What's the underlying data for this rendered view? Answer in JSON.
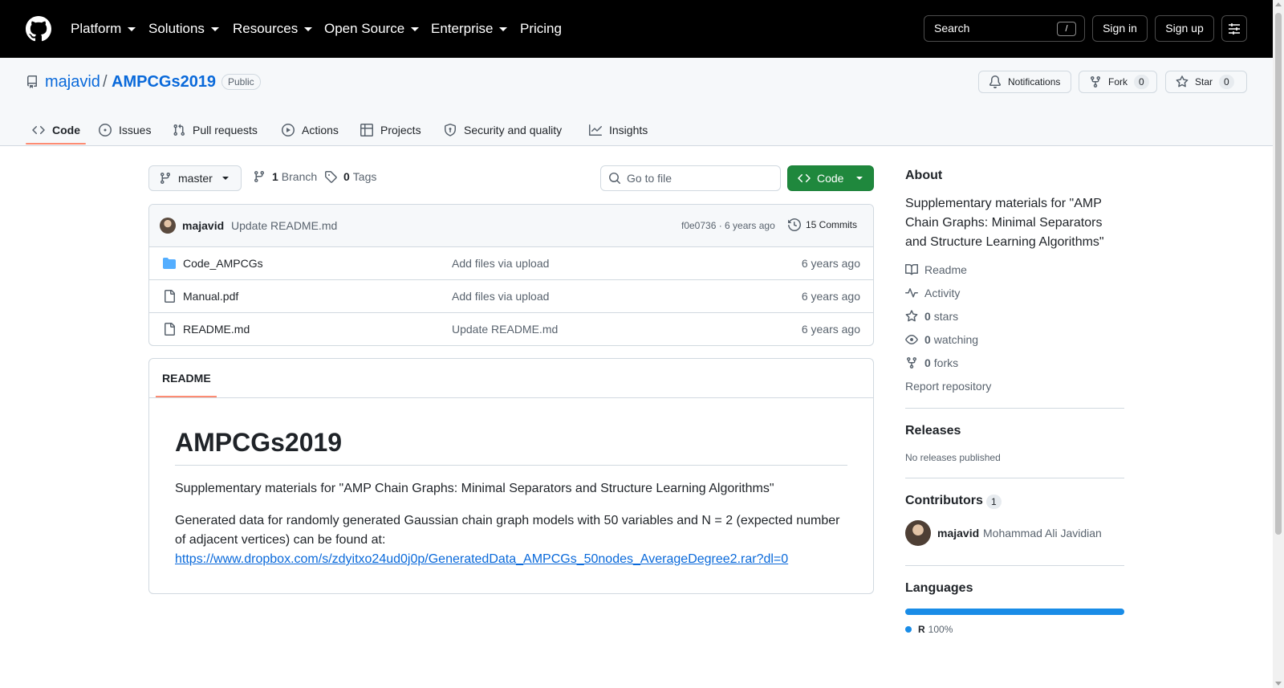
{
  "global_nav": {
    "logo": "github-mark-icon",
    "items": [
      {
        "label": "Platform",
        "has_dropdown": true
      },
      {
        "label": "Solutions",
        "has_dropdown": true
      },
      {
        "label": "Resources",
        "has_dropdown": true
      },
      {
        "label": "Open Source",
        "has_dropdown": true
      },
      {
        "label": "Enterprise",
        "has_dropdown": true
      },
      {
        "label": "Pricing",
        "has_dropdown": false
      }
    ],
    "search_label": "Search",
    "search_shortcut": "/",
    "sign_in": "Sign in",
    "sign_up": "Sign up"
  },
  "repo": {
    "owner": "majavid",
    "separator": "/",
    "name": "AMPCGs2019",
    "visibility": "Public",
    "actions": {
      "notifications": "Notifications",
      "fork_label": "Fork",
      "fork_count": "0",
      "star_label": "Star",
      "star_count": "0"
    },
    "tabs": [
      {
        "label": "Code",
        "icon": "code-icon",
        "active": true
      },
      {
        "label": "Issues",
        "icon": "issue-opened-icon"
      },
      {
        "label": "Pull requests",
        "icon": "git-pull-request-icon"
      },
      {
        "label": "Actions",
        "icon": "play-icon"
      },
      {
        "label": "Projects",
        "icon": "table-icon"
      },
      {
        "label": "Security and quality",
        "icon": "shield-icon"
      },
      {
        "label": "Insights",
        "icon": "graph-icon"
      }
    ]
  },
  "toolbar": {
    "branch": "master",
    "branch_count": "1",
    "branch_label": "Branch",
    "tag_count": "0",
    "tag_label": "Tags",
    "goto_placeholder": "Go to file",
    "code_button": "Code"
  },
  "latest_commit": {
    "author": "majavid",
    "message": "Update README.md",
    "meta": "f0e0736 · 6 years ago",
    "commits": "15 Commits"
  },
  "files": [
    {
      "name": "Code_AMPCGs",
      "type": "folder",
      "message": "Add files via upload",
      "age": "6 years ago"
    },
    {
      "name": "Manual.pdf",
      "type": "file",
      "message": "Add files via upload",
      "age": "6 years ago"
    },
    {
      "name": "README.md",
      "type": "file",
      "message": "Update README.md",
      "age": "6 years ago"
    }
  ],
  "readme": {
    "tab_label": "README",
    "heading": "AMPCGs2019",
    "paragraph1": "Supplementary materials for \"AMP Chain Graphs: Minimal Separators and Structure Learning Algorithms\"",
    "paragraph2": "Generated data for randomly generated Gaussian chain graph models with 50 variables and N = 2 (expected number of adjacent vertices) can be found at:",
    "link": "https://www.dropbox.com/s/zdyitxo24ud0j0p/GeneratedData_AMPCGs_50nodes_AverageDegree2.rar?dl=0"
  },
  "about": {
    "heading": "About",
    "description": "Supplementary materials for \"AMP Chain Graphs: Minimal Separators and Structure Learning Algorithms\"",
    "readme": "Readme",
    "activity": "Activity",
    "stars_count": "0",
    "stars_label": "stars",
    "watching_count": "0",
    "watching_label": "watching",
    "forks_count": "0",
    "forks_label": "forks",
    "report": "Report repository"
  },
  "releases": {
    "heading": "Releases",
    "empty": "No releases published"
  },
  "contributors": {
    "heading": "Contributors",
    "count": "1",
    "items": [
      {
        "login": "majavid",
        "name": "Mohammad Ali Javidian"
      }
    ]
  },
  "languages": {
    "heading": "Languages",
    "items": [
      {
        "name": "R",
        "percent": "100%",
        "share": 1.0,
        "color": "#198ce7"
      }
    ]
  },
  "colors": {
    "header_bg": "#000000",
    "link": "#0969da",
    "primary_button": "#1f883d",
    "tab_underline": "#fd8c73"
  }
}
